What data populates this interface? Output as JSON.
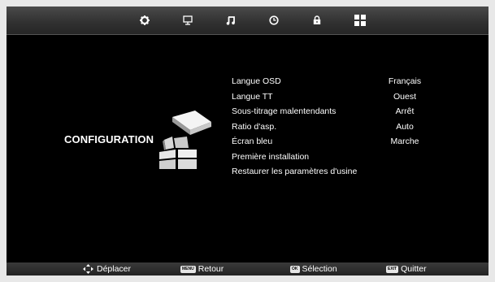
{
  "tabs": [
    {
      "icon": "gear-icon",
      "selected": true
    },
    {
      "icon": "monitor-icon",
      "selected": false
    },
    {
      "icon": "music-note-icon",
      "selected": false
    },
    {
      "icon": "clock-icon",
      "selected": false
    },
    {
      "icon": "lock-icon",
      "selected": false
    },
    {
      "icon": "grid-icon",
      "selected": false
    }
  ],
  "section": {
    "title": "CONFIGURATION",
    "icon": "configuration-icon"
  },
  "menu": [
    {
      "label": "Langue OSD",
      "value": "Français"
    },
    {
      "label": "Langue TT",
      "value": "Ouest"
    },
    {
      "label": "Sous-titrage malentendants",
      "value": "Arrêt"
    },
    {
      "label": "Ratio d'asp.",
      "value": "Auto"
    },
    {
      "label": "Écran bleu",
      "value": "Marche"
    },
    {
      "label": "Première installation",
      "value": ""
    },
    {
      "label": "Restaurer les paramètres d'usine",
      "value": ""
    }
  ],
  "footer": {
    "move": {
      "icon": "dpad-icon",
      "label": "Déplacer"
    },
    "back": {
      "key": "MENU",
      "label": "Retour"
    },
    "select": {
      "key": "OK",
      "label": "Sélection"
    },
    "exit": {
      "key": "EXIT",
      "label": "Quitter"
    }
  },
  "colors": {
    "background": "#000000",
    "text": "#ffffff",
    "bar": "#2e2e2e"
  }
}
